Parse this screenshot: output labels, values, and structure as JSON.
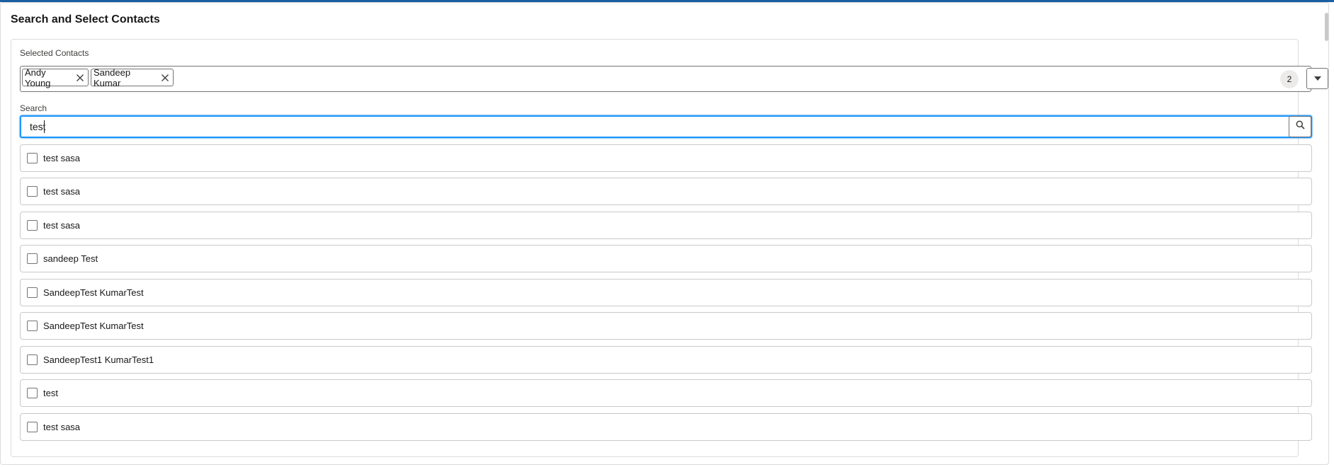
{
  "title": "Search and Select Contacts",
  "selected": {
    "label": "Selected Contacts",
    "pills": [
      {
        "name": "Andy Young"
      },
      {
        "name": "Sandeep Kumar"
      }
    ],
    "count": "2"
  },
  "search": {
    "label": "Search",
    "value": "test"
  },
  "results": [
    {
      "label": "test sasa"
    },
    {
      "label": "test sasa"
    },
    {
      "label": "test sasa"
    },
    {
      "label": "sandeep Test"
    },
    {
      "label": "SandeepTest KumarTest"
    },
    {
      "label": "SandeepTest KumarTest"
    },
    {
      "label": "SandeepTest1 KumarTest1"
    },
    {
      "label": "test"
    },
    {
      "label": "test sasa"
    }
  ],
  "colors": {
    "focus_border": "#1b96ff",
    "top_strip": "#1b5fa3"
  },
  "icons": {
    "remove": "close-icon",
    "dropdown": "chevron-down-icon",
    "search": "search-icon"
  }
}
